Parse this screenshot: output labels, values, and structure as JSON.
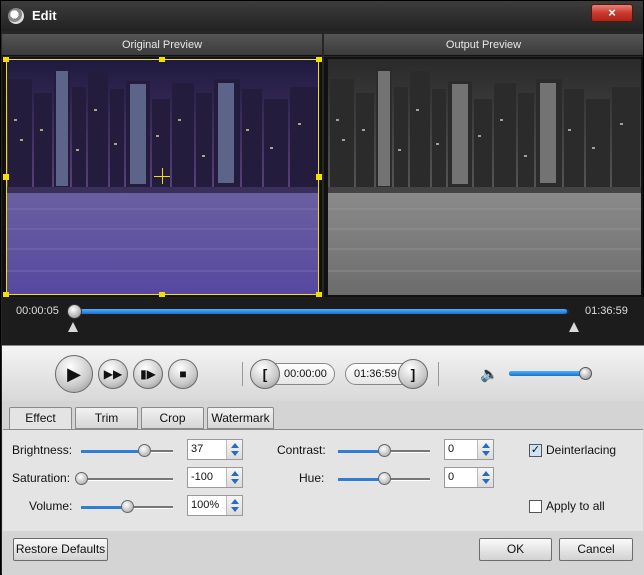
{
  "window": {
    "title": "Edit",
    "close_icon": "×"
  },
  "preview": {
    "original_label": "Original Preview",
    "output_label": "Output Preview"
  },
  "timeline": {
    "start_time": "00:00:05",
    "end_time": "01:36:59",
    "position_fraction": 0.001
  },
  "playback": {
    "play_icon": "▶",
    "fast_forward_icon": "▶▶",
    "frame_step_icon": "▮▶",
    "stop_icon": "■",
    "start_value": "00:00:00",
    "end_value": "01:36:59",
    "set_start_icon": "[",
    "set_end_icon": "]",
    "volume_icon": "🔈",
    "volume_fraction": 0.98
  },
  "tabs": [
    {
      "label": "Effect",
      "active": true
    },
    {
      "label": "Trim",
      "active": false
    },
    {
      "label": "Crop",
      "active": false
    },
    {
      "label": "Watermark",
      "active": false
    }
  ],
  "effect": {
    "brightness": {
      "label": "Brightness:",
      "value": "37",
      "fraction": 0.68
    },
    "saturation": {
      "label": "Saturation:",
      "value": "-100",
      "fraction": 0.0
    },
    "volume": {
      "label": "Volume:",
      "value": "100%",
      "fraction": 0.5
    },
    "contrast": {
      "label": "Contrast:",
      "value": "0",
      "fraction": 0.5
    },
    "hue": {
      "label": "Hue:",
      "value": "0",
      "fraction": 0.5
    },
    "deinterlacing": {
      "label": "Deinterlacing",
      "checked": true
    },
    "apply_to_all": {
      "label": "Apply to all",
      "checked": false
    }
  },
  "buttons": {
    "restore_defaults": "Restore Defaults",
    "ok": "OK",
    "cancel": "Cancel"
  },
  "colors": {
    "accent_blue": "#2e7fd3",
    "timeline_track": "#0f3760",
    "crop_handle": "#f3e000"
  }
}
